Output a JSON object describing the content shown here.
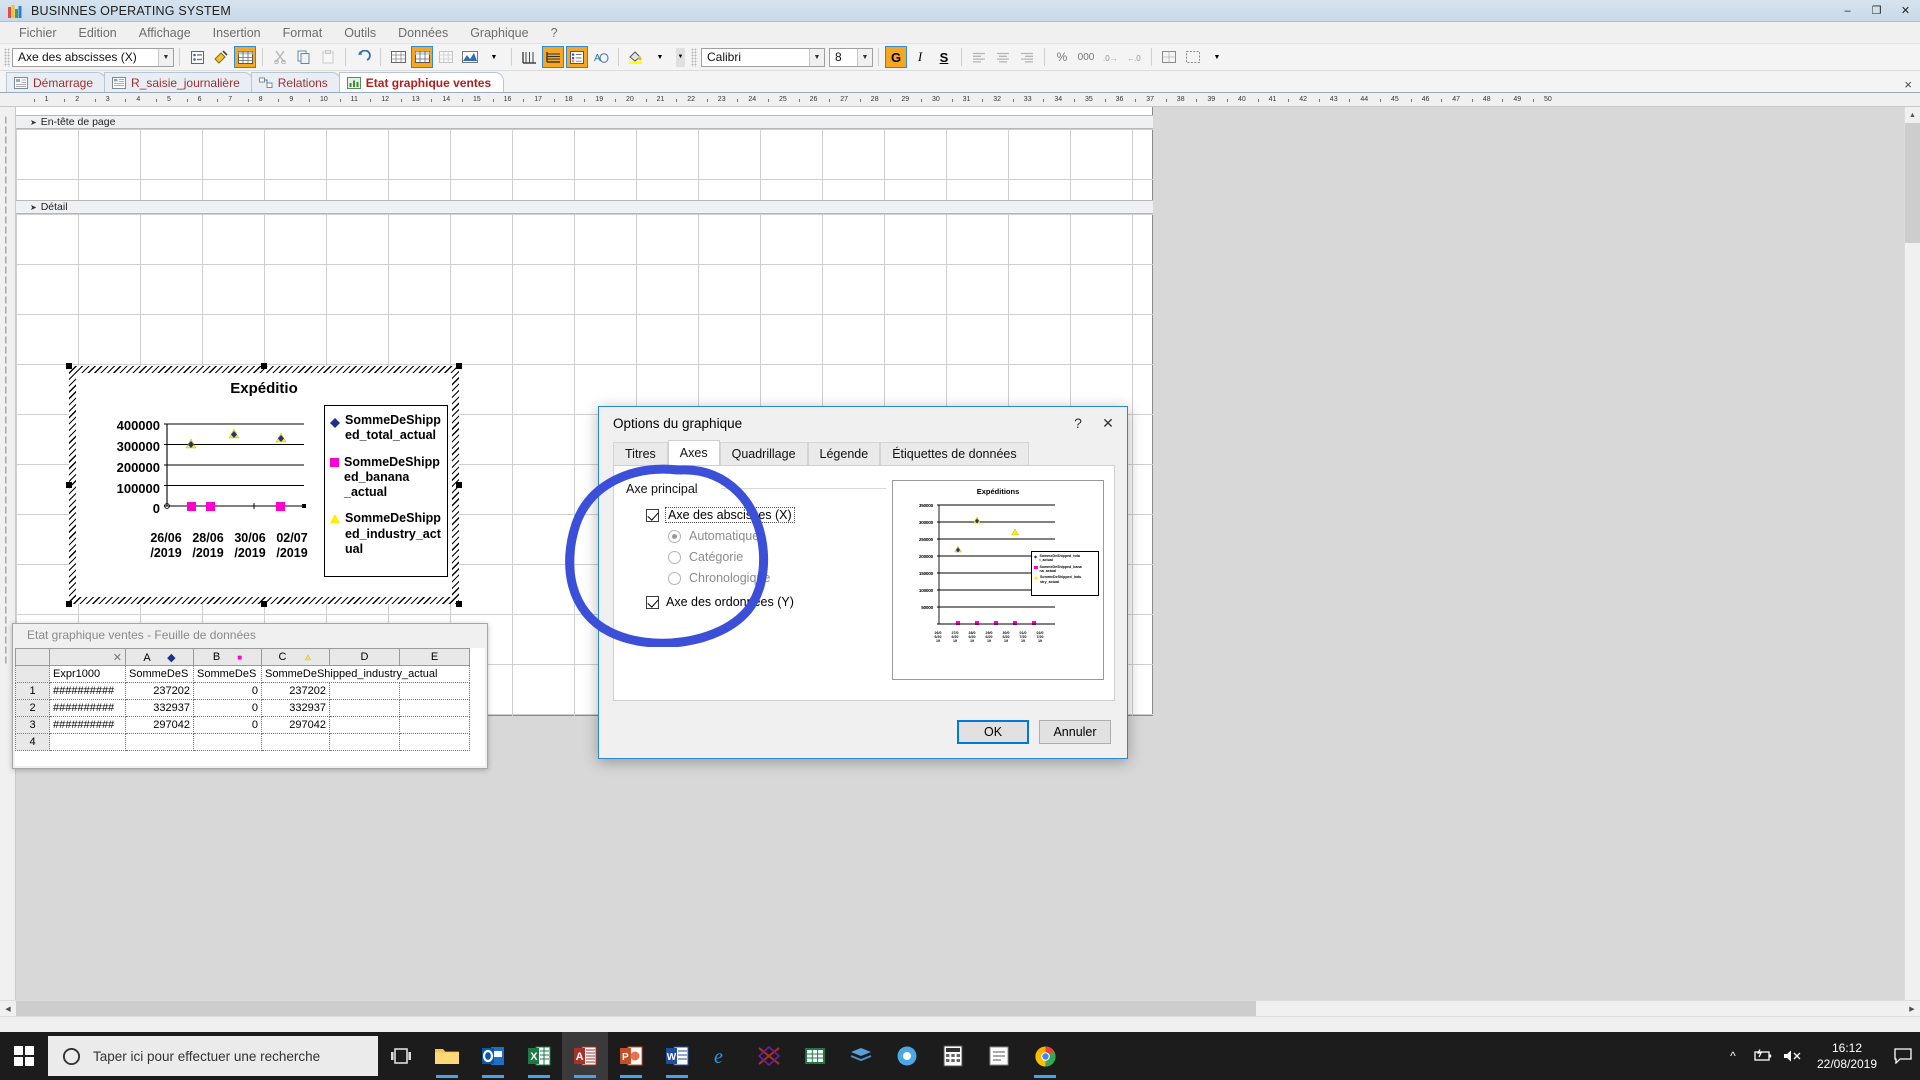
{
  "window": {
    "title": "BUSINNES OPERATING SYSTEM",
    "minimize": "–",
    "maximize": "❐",
    "close": "✕"
  },
  "menubar": {
    "items": [
      "Fichier",
      "Edition",
      "Affichage",
      "Insertion",
      "Format",
      "Outils",
      "Données",
      "Graphique",
      "?"
    ]
  },
  "toolbar": {
    "object_select": "Axe des abscisses (X)",
    "font_name": "Calibri",
    "font_size": "8",
    "bold": "G",
    "italic": "I",
    "underline": "S"
  },
  "document_tabs": [
    {
      "label": "Démarrage",
      "active": false
    },
    {
      "label": "R_saisie_journalière",
      "active": false
    },
    {
      "label": "Relations",
      "active": false
    },
    {
      "label": "Etat graphique ventes",
      "active": true
    }
  ],
  "tabbar": {
    "close_label": "×"
  },
  "report": {
    "sections": [
      {
        "label": "En-tête de page"
      },
      {
        "label": "Détail"
      }
    ]
  },
  "chart_data": {
    "type": "scatter",
    "title": "Expéditio",
    "xlabel": "",
    "ylabel": "",
    "ylim": [
      0,
      400000
    ],
    "yticks": [
      "400000",
      "300000",
      "200000",
      "100000",
      "0"
    ],
    "ytick_values": [
      400000,
      300000,
      200000,
      100000,
      0
    ],
    "xticks": [
      "26/06\n/2019",
      "28/06\n/2019",
      "30/06\n/2019",
      "02/07\n/2019"
    ],
    "xtick_labels": [
      {
        "l1": "26/06",
        "l2": "/2019"
      },
      {
        "l1": "28/06",
        "l2": "/2019"
      },
      {
        "l1": "30/06",
        "l2": "/2019"
      },
      {
        "l1": "02/07",
        "l2": "/2019"
      }
    ],
    "grid": true,
    "legend_position": "right",
    "series": [
      {
        "name": "SommeDeShipped_total_actual",
        "marker": "diamond",
        "color": "#1f2f8f",
        "values": [
          237202,
          332937,
          null,
          297042
        ]
      },
      {
        "name": "SommeDeShipped_banana_actual",
        "marker": "square",
        "color": "#ff00d0",
        "values": [
          0,
          0,
          null,
          0
        ]
      },
      {
        "name": "SommeDeShipped_industry_actual",
        "marker": "triangle",
        "color": "#ffee00",
        "values": [
          237202,
          332937,
          null,
          297042
        ]
      }
    ],
    "legend_lines": [
      [
        "SommeDeShipp",
        "ed_total_actual"
      ],
      [
        "SommeDeShipp",
        "ed_banana",
        "_actual"
      ],
      [
        "SommeDeShipp",
        "ed_industry_act",
        "ual"
      ]
    ]
  },
  "datasheet": {
    "title": "Etat graphique ventes - Feuille de données",
    "column_letters": [
      "",
      "",
      "A",
      "B",
      "C",
      "D",
      "E"
    ],
    "column_markers": [
      "",
      "",
      "diamond",
      "square",
      "triangle",
      "",
      ""
    ],
    "field_headers": [
      "Expr1000",
      "SommeDeS",
      "SommeDeS",
      "SommeDeShipped_industry_actual",
      "",
      ""
    ],
    "rows": [
      {
        "num": "1",
        "cells": [
          "##########",
          "237202",
          "0",
          "237202",
          "",
          ""
        ]
      },
      {
        "num": "2",
        "cells": [
          "##########",
          "332937",
          "0",
          "332937",
          "",
          ""
        ]
      },
      {
        "num": "3",
        "cells": [
          "##########",
          "297042",
          "0",
          "297042",
          "",
          ""
        ]
      },
      {
        "num": "4",
        "cells": [
          "",
          "",
          "",
          "",
          "",
          ""
        ]
      }
    ]
  },
  "dialog": {
    "title": "Options du graphique",
    "help_icon": "?",
    "close_icon": "✕",
    "tabs": [
      {
        "label": "Titres",
        "selected": false
      },
      {
        "label": "Axes",
        "selected": true
      },
      {
        "label": "Quadrillage",
        "selected": false
      },
      {
        "label": "Légende",
        "selected": false
      },
      {
        "label": "Étiquettes de données",
        "selected": false
      }
    ],
    "group_label": "Axe principal",
    "checkbox_x": {
      "label": "Axe des abscisses (X)",
      "checked": true
    },
    "radios": [
      {
        "label": "Automatique",
        "selected": true
      },
      {
        "label": "Catégorie",
        "selected": false
      },
      {
        "label": "Chronologique",
        "selected": false
      }
    ],
    "checkbox_y": {
      "label": "Axe des ordonnées (Y)",
      "checked": true
    },
    "buttons": {
      "ok": "OK",
      "cancel": "Annuler"
    },
    "preview": {
      "title": "Expéditions",
      "yticks": [
        "350000",
        "300000",
        "250000",
        "200000",
        "150000",
        "100000",
        "50000"
      ],
      "xticks": [
        "26/0\n6/20\n19",
        "27/0\n6/20\n19",
        "28/0\n6/20\n19",
        "29/0\n6/20\n19",
        "30/0\n6/20\n19",
        "01/0\n7/20\n19",
        "02/0\n7/20\n19"
      ],
      "legend_lines": [
        [
          "SommeDeShipped_tota",
          "l_actual"
        ],
        [
          "SommeDeShipped_bana",
          "na_actual"
        ],
        [
          "SommeDeShipped_indu",
          "stry_actual"
        ]
      ]
    }
  },
  "annotation": {
    "shape": "hand-drawn-ellipse",
    "color": "#3b4fd8"
  },
  "taskbar": {
    "search_placeholder": "Taper ici pour effectuer une recherche",
    "time": "16:12",
    "date": "22/08/2019",
    "apps": [
      "task-view",
      "file-explorer",
      "outlook",
      "excel",
      "access",
      "powerpoint",
      "word",
      "edge",
      "visio",
      "excel2",
      "onenote-alt",
      "chrome-alt",
      "calculator",
      "notepad",
      "chrome"
    ]
  }
}
